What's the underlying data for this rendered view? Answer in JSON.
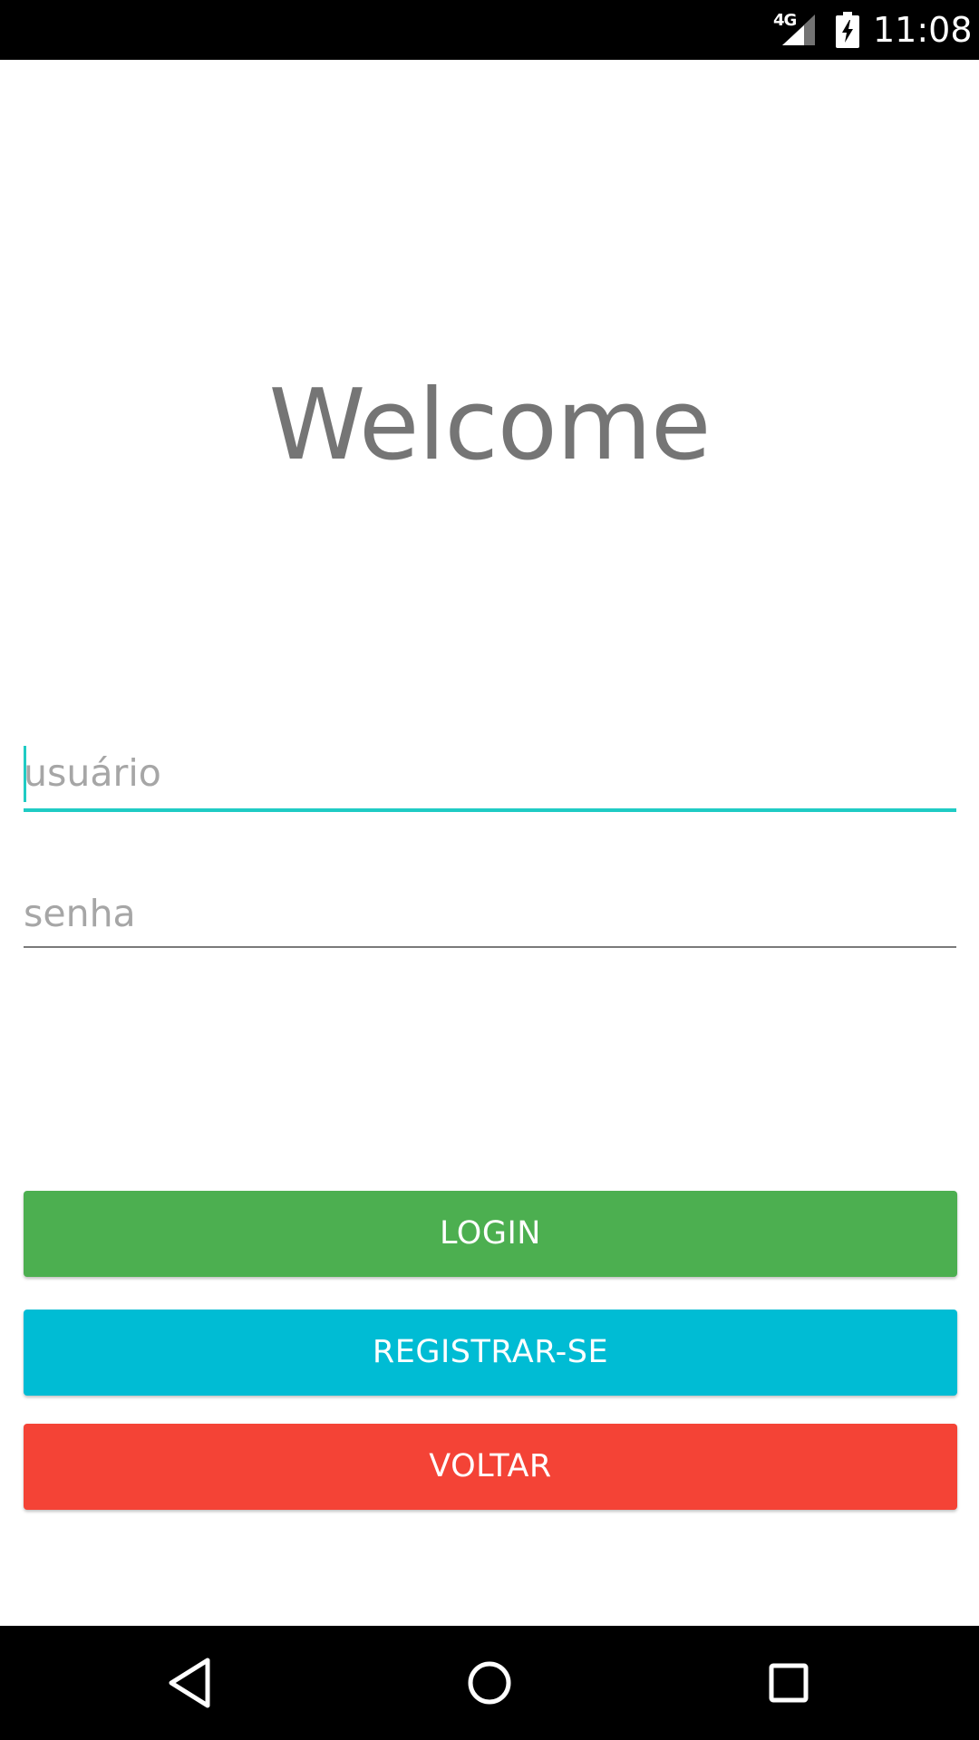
{
  "status_bar": {
    "network": "4G",
    "time": "11:08",
    "icons": [
      "signal-icon",
      "battery-charging-icon"
    ]
  },
  "welcome": {
    "title": "Welcome"
  },
  "form": {
    "username_placeholder": "usuário",
    "username_value": "",
    "password_placeholder": "senha",
    "password_value": ""
  },
  "buttons": {
    "login": "LOGIN",
    "register": "REGISTRAR-SE",
    "back": "VOLTAR"
  },
  "nav_bar": {
    "icons": [
      "back-icon",
      "home-icon",
      "recents-icon"
    ]
  },
  "colors": {
    "accent": "#1fcbc4",
    "login": "#4caf50",
    "register": "#00bcd4",
    "back": "#f44336",
    "title_text": "#757575"
  }
}
